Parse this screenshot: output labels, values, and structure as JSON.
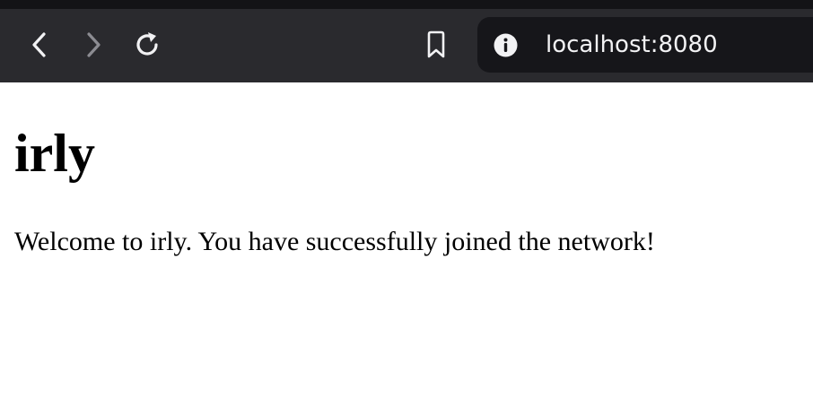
{
  "browser": {
    "url": "localhost:8080",
    "icons": {
      "back": "chevron-left-icon",
      "forward": "chevron-right-icon",
      "reload": "reload-icon",
      "bookmark": "bookmark-icon",
      "site_info": "info-icon"
    },
    "colors": {
      "toolbar_bg": "#2a2a2e",
      "urlbar_bg": "#16161a",
      "icon_active": "#f2f2f4",
      "icon_disabled": "#8c8c92"
    }
  },
  "page": {
    "heading": "irly",
    "message": "Welcome to irly. You have successfully joined the network!"
  }
}
